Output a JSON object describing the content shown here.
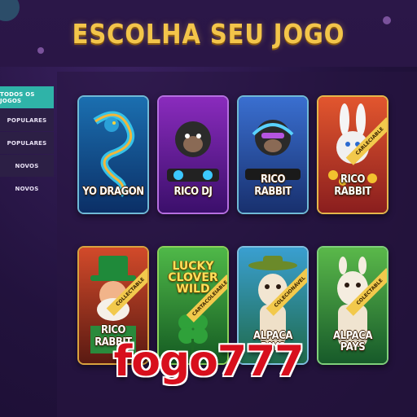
{
  "header": {
    "title": "ESCOLHA SEU JOGO"
  },
  "sidebar": {
    "items": [
      {
        "label": "TODOS OS JOGOS",
        "active": true
      },
      {
        "label": "POPULARES"
      },
      {
        "label": "POPULARES"
      },
      {
        "label": "NOVOS"
      },
      {
        "label": "NOVOS"
      }
    ]
  },
  "games": [
    {
      "title": "YO DRAGON",
      "icon": "dragon-icon"
    },
    {
      "title": "RICO DJ",
      "icon": "gorilla-dj-icon"
    },
    {
      "title": "RICO RABBIT",
      "icon": "gorilla-icon"
    },
    {
      "title": "RICO RABBIT",
      "badge": "CARLECIABLE",
      "icon": "rabbit-icon"
    },
    {
      "title": "RICO RABBIT",
      "badge": "COLLECTABLE",
      "icon": "leprechaun-icon"
    },
    {
      "title": "",
      "top_text": "LUCKY CLOVER WILD",
      "badge": "CARTACOLEIABLE",
      "icon": "clover-icon"
    },
    {
      "title": "ALPACA PAYS",
      "badge": "COLECIONÁVEL",
      "icon": "alpaca-icon"
    },
    {
      "title": "ALPACA PAYS",
      "badge": "COLECTABLE",
      "icon": "alpaca-icon"
    }
  ],
  "watermark": "fogo777",
  "colors": {
    "accent": "#2fb3a8",
    "title": "#f3c54a",
    "watermark": "#d80f1d"
  }
}
